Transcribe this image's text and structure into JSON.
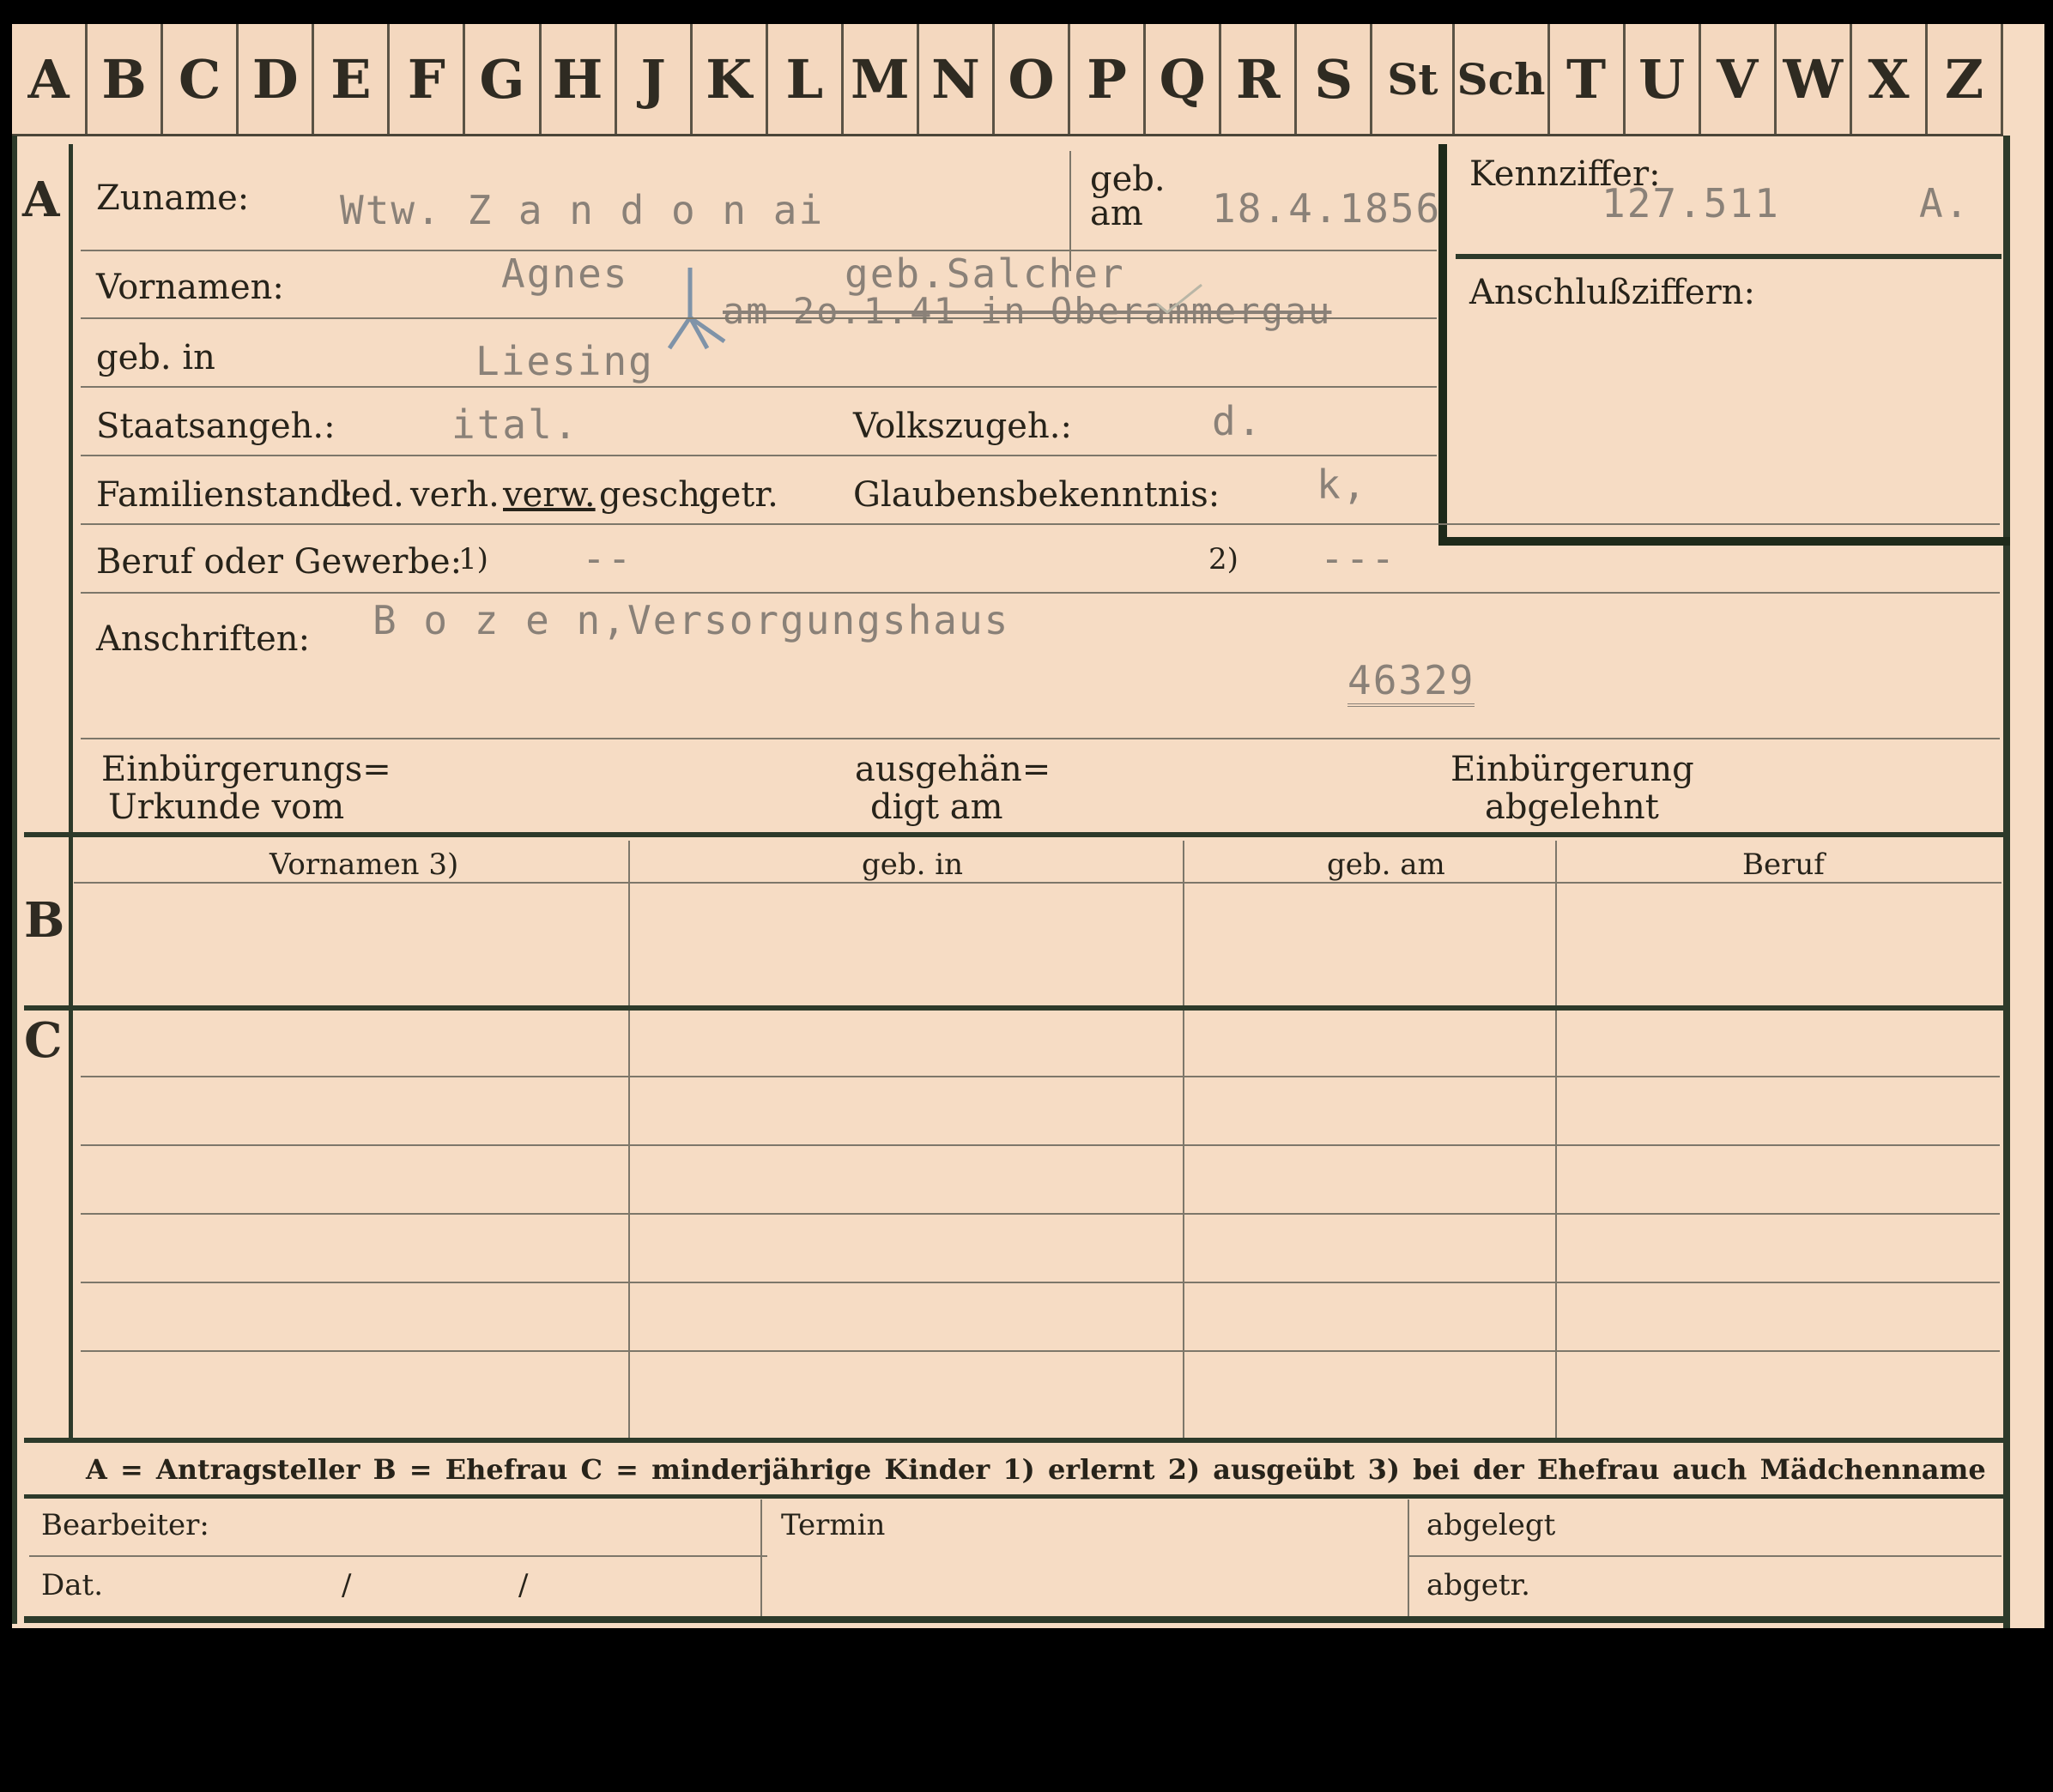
{
  "letters": [
    "A",
    "B",
    "C",
    "D",
    "E",
    "F",
    "G",
    "H",
    "J",
    "K",
    "L",
    "M",
    "N",
    "O",
    "P",
    "Q",
    "R",
    "S",
    "St",
    "Sch",
    "T",
    "U",
    "V",
    "W",
    "X",
    "Z"
  ],
  "section_a": {
    "marker": "A",
    "zuname_label": "Zuname:",
    "zuname_value": "Wtw. Z a n d o n ai",
    "geb_am_label_1": "geb.",
    "geb_am_label_2": "am",
    "geb_am_value": "18.4.1856",
    "kennziffer_label": "Kennziffer:",
    "kennziffer_value": "127.511",
    "kennziffer_suffix": "A.",
    "anschluss_label": "Anschlußziffern:",
    "vornamen_label": "Vornamen:",
    "vornamen_value": "Agnes",
    "maiden_value": "geb.Salcher",
    "deceased_note": "am 2o.1.41 in Oberammergau",
    "geb_in_label": "geb. in",
    "geb_in_value": "Liesing",
    "staat_label": "Staatsangeh.:",
    "staat_value": "ital.",
    "volk_label": "Volkszugeh.:",
    "volk_value": "d.",
    "familienstand_label": "Familienstand:",
    "familienstand_options": [
      "led.",
      "verh.",
      "verw.",
      "gesch.",
      "getr."
    ],
    "glauben_label": "Glaubensbekenntnis:",
    "glauben_value": "k,",
    "beruf_label": "Beruf oder Gewerbe:",
    "beruf_mark_1": "1)",
    "beruf_value_1": "--",
    "beruf_mark_2": "2)",
    "beruf_value_2": "---",
    "anschriften_label": "Anschriften:",
    "anschriften_value": "B o z e n,Versorgungshaus",
    "file_number": "46329",
    "urkunde_label_1": "Einbürgerungs=",
    "urkunde_label_2": "Urkunde vom",
    "ausgehaendigt_label_1": "ausgehän=",
    "ausgehaendigt_label_2": "digt am",
    "abgelehnt_label_1": "Einbürgerung",
    "abgelehnt_label_2": "abgelehnt"
  },
  "section_b": {
    "marker": "B",
    "columns": [
      "Vornamen 3)",
      "geb. in",
      "geb. am",
      "Beruf"
    ]
  },
  "section_c": {
    "marker": "C"
  },
  "legend": "A = Antragsteller   B = Ehefrau   C = minderjährige Kinder   1) erlernt   2) ausgeübt   3) bei der Ehefrau auch Mädchenname",
  "footer": {
    "bearbeiter_label": "Bearbeiter:",
    "dat_label": "Dat.",
    "dat_slash": "/",
    "termin_label": "Termin",
    "abgelegt_label": "abgelegt",
    "abgetr_label": "abgetr."
  }
}
